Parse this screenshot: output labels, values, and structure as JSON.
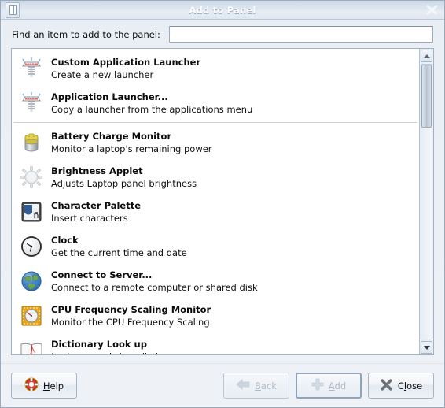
{
  "window": {
    "title": "Add to Panel",
    "menu_icon": "window-menu-icon",
    "close_icon": "close-icon"
  },
  "search": {
    "label_prefix": "Find an ",
    "label_mnemonic": "i",
    "label_suffix": "tem to add to the panel:",
    "value": "",
    "placeholder": ""
  },
  "list": {
    "groups": [
      {
        "items": [
          {
            "icon": "launcher-icon",
            "title": "Custom Application Launcher",
            "description": "Create a new launcher"
          },
          {
            "icon": "launcher-icon",
            "title": "Application Launcher...",
            "description": "Copy a launcher from the applications menu"
          }
        ]
      },
      {
        "items": [
          {
            "icon": "battery-icon",
            "title": "Battery Charge Monitor",
            "description": "Monitor a laptop's remaining power"
          },
          {
            "icon": "brightness-icon",
            "title": "Brightness Applet",
            "description": "Adjusts Laptop panel brightness"
          },
          {
            "icon": "character-palette-icon",
            "title": "Character Palette",
            "description": "Insert characters"
          },
          {
            "icon": "clock-icon",
            "title": "Clock",
            "description": "Get the current time and date"
          },
          {
            "icon": "globe-icon",
            "title": "Connect to Server...",
            "description": "Connect to a remote computer or shared disk"
          },
          {
            "icon": "cpu-chip-icon",
            "title": "CPU Frequency Scaling Monitor",
            "description": "Monitor the CPU Frequency Scaling"
          },
          {
            "icon": "dictionary-book-icon",
            "title": "Dictionary Look up",
            "description": "Look up words in a dictionary"
          }
        ]
      }
    ]
  },
  "scrollbar": {
    "up_icon": "scroll-up-arrow-icon",
    "down_icon": "scroll-down-arrow-icon",
    "thumb_position_percent": 0,
    "thumb_size_percent": 23
  },
  "buttons": {
    "help": {
      "icon": "help-lifering-icon",
      "mnemonic": "H",
      "label_rest": "elp",
      "enabled": true
    },
    "back": {
      "icon": "back-arrow-icon",
      "mnemonic": "B",
      "label_rest": "ack",
      "enabled": false
    },
    "add": {
      "icon": "plus-icon",
      "mnemonic": "A",
      "label_rest": "dd",
      "enabled": false,
      "is_default": true
    },
    "close": {
      "icon": "close-x-icon",
      "label_prefix": "C",
      "mnemonic": "l",
      "label_rest": "ose",
      "enabled": true
    }
  },
  "colors": {
    "titlebar_top": "#cfdae8",
    "dialog_bg": "#eef2f7",
    "list_bg": "#ffffff",
    "text": "#0b0b0b",
    "disabled_text": "#b0bac6"
  }
}
